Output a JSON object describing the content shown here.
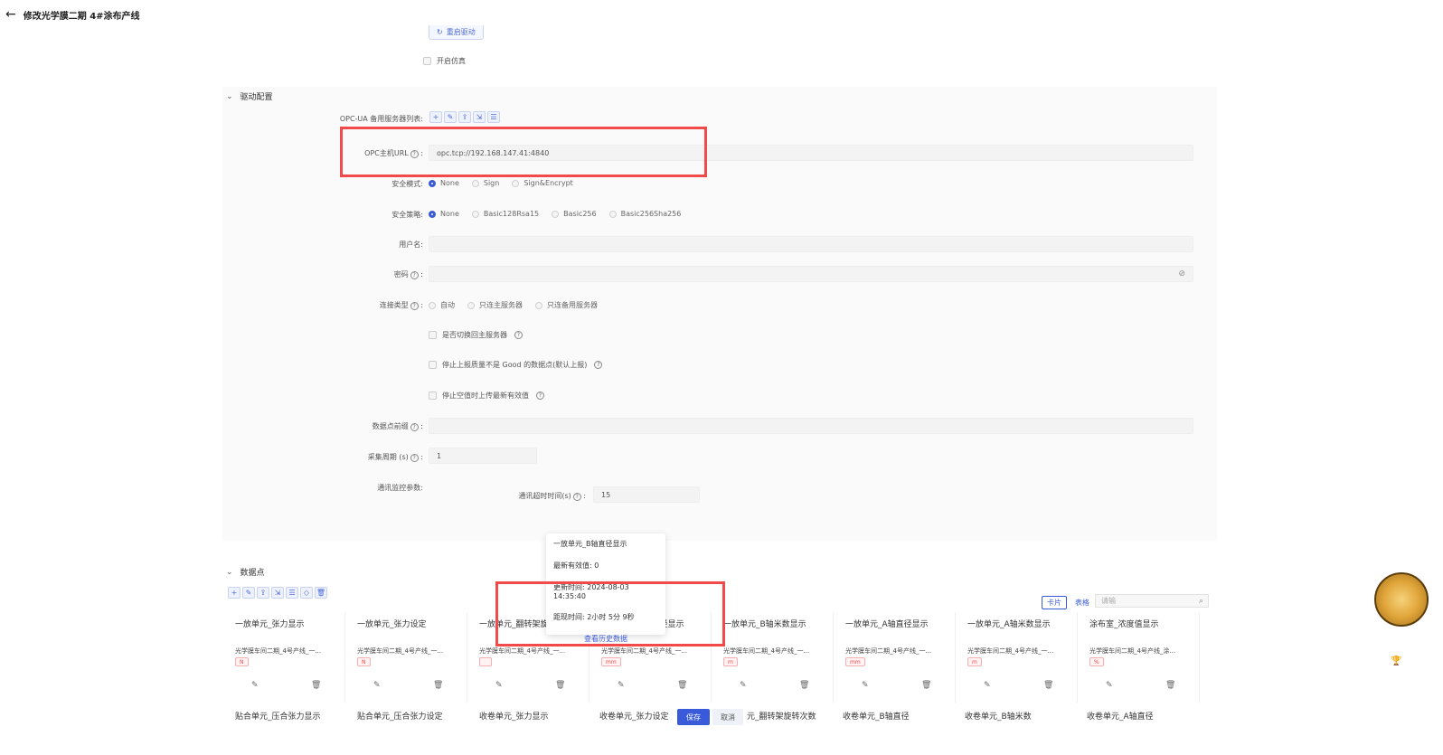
{
  "header": {
    "back_icon": "arrow-left-icon",
    "title": "修改光学膜二期 4#涂布产线"
  },
  "top": {
    "restart_label": "重启驱动",
    "simulate_label": "开启仿真"
  },
  "driver": {
    "section_title": "驱动配置",
    "opc_backup_label": "OPC-UA 备用服务器列表:",
    "opc_url_label": "OPC主机URL",
    "opc_url_value": "opc.tcp://192.168.147.41:4840",
    "security_mode_label": "安全模式:",
    "security_mode_options": [
      "None",
      "Sign",
      "Sign&Encrypt"
    ],
    "security_policy_label": "安全策略:",
    "security_policy_options": [
      "None",
      "Basic128Rsa15",
      "Basic256",
      "Basic256Sha256"
    ],
    "username_label": "用户名:",
    "password_label": "密码",
    "conn_type_label": "连接类型",
    "conn_type_options": [
      "自动",
      "只连主服务器",
      "只连备用服务器"
    ],
    "switch_back_label": "是否切换回主服务器",
    "stop_not_good_label": "停止上报质量不是 Good 的数据点(默认上报)",
    "stop_empty_label": "停止空值时上传最新有效值",
    "datapoint_prefix_label": "数据点前缀",
    "collect_period_label": "采集周期 (s)",
    "collect_period_value": "1",
    "comm_monitor_label": "通讯监控参数:",
    "comm_timeout_label": "通讯超时时间(s)",
    "comm_timeout_value": "15"
  },
  "popover": {
    "title": "一放单元_B轴直径显示",
    "latest": "最新有效值: 0",
    "updated": "更新时间: 2024-08-03 14:35:40",
    "distance": "距现时间: 2小时 5分 9秒",
    "history_link": "查看历史数据"
  },
  "datapoints": {
    "section_title": "数据点",
    "view_card": "卡片",
    "view_table": "表格",
    "search_placeholder": "请输",
    "cards": [
      {
        "title": "一放单元_张力显示",
        "sub": "光学膜车间二期_4号产线_一...",
        "unit": "N"
      },
      {
        "title": "一放单元_张力设定",
        "sub": "光学膜车间二期_4号产线_一...",
        "unit": "N"
      },
      {
        "title": "一放单元_翻转架旋",
        "sub": "光学膜车间二期_4号产线_一...",
        "unit": ""
      },
      {
        "title": "一放单元_B轴直径显示",
        "sub": "光学膜车间二期_4号产线_一...",
        "unit": "mm"
      },
      {
        "title": "一放单元_B轴米数显示",
        "sub": "光学膜车间二期_4号产线_一...",
        "unit": "m"
      },
      {
        "title": "一放单元_A轴直径显示",
        "sub": "光学膜车间二期_4号产线_一...",
        "unit": "mm"
      },
      {
        "title": "一放单元_A轴米数显示",
        "sub": "光学膜车间二期_4号产线_一...",
        "unit": "m"
      },
      {
        "title": "涂布室_浓度值显示",
        "sub": "光学膜车间二期_4号产线_涂...",
        "unit": "%"
      }
    ],
    "row2": [
      "贴合单元_压合张力显示",
      "贴合单元_压合张力设定",
      "收卷单元_张力显示",
      "收卷单元_张力设定",
      "元_翻转架旋转次数",
      "收卷单元_B轴直径",
      "收卷单元_B轴米数",
      "收卷单元_A轴直径"
    ],
    "save_label": "保存",
    "cancel_label": "取消"
  }
}
